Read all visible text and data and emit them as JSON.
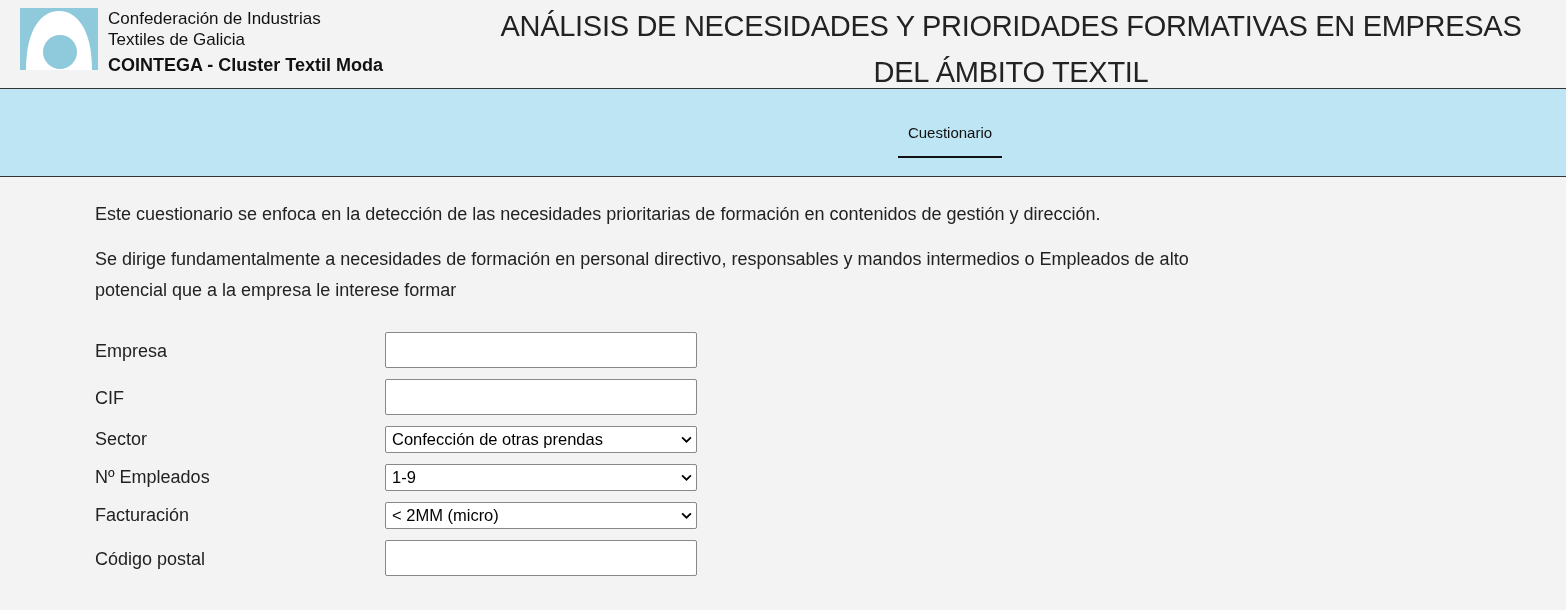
{
  "brand": {
    "line_1": "Confederación de Industrias",
    "line_2": "Textiles de Galicia",
    "line_3": "COINTEGA - Cluster Textil Moda"
  },
  "title": "ANÁLISIS DE NECESIDADES Y PRIORIDADES FORMATIVAS EN EMPRESAS DEL ÁMBITO TEXTIL",
  "tabs": [
    {
      "label": "Cuestionario",
      "selected": true
    }
  ],
  "intro": [
    "Este cuestionario se enfoca en la detección de las necesidades prioritarias de formación en contenidos de gestión y dirección.",
    "Se dirige fundamentalmente a necesidades de formación en personal directivo, responsables y mandos intermedios o Empleados de alto potencial que a la empresa le interese formar"
  ],
  "fields": [
    {
      "label": "Empresa",
      "kind": "text"
    },
    {
      "label": "CIF",
      "kind": "text"
    },
    {
      "label": "Sector",
      "kind": "select",
      "value": "Confección de otras prendas"
    },
    {
      "label": "Nº Empleados",
      "kind": "select",
      "value": "1-9"
    },
    {
      "label": "Facturación",
      "kind": "select",
      "value": "< 2MM (micro)"
    },
    {
      "label": "Código postal",
      "kind": "text"
    }
  ]
}
